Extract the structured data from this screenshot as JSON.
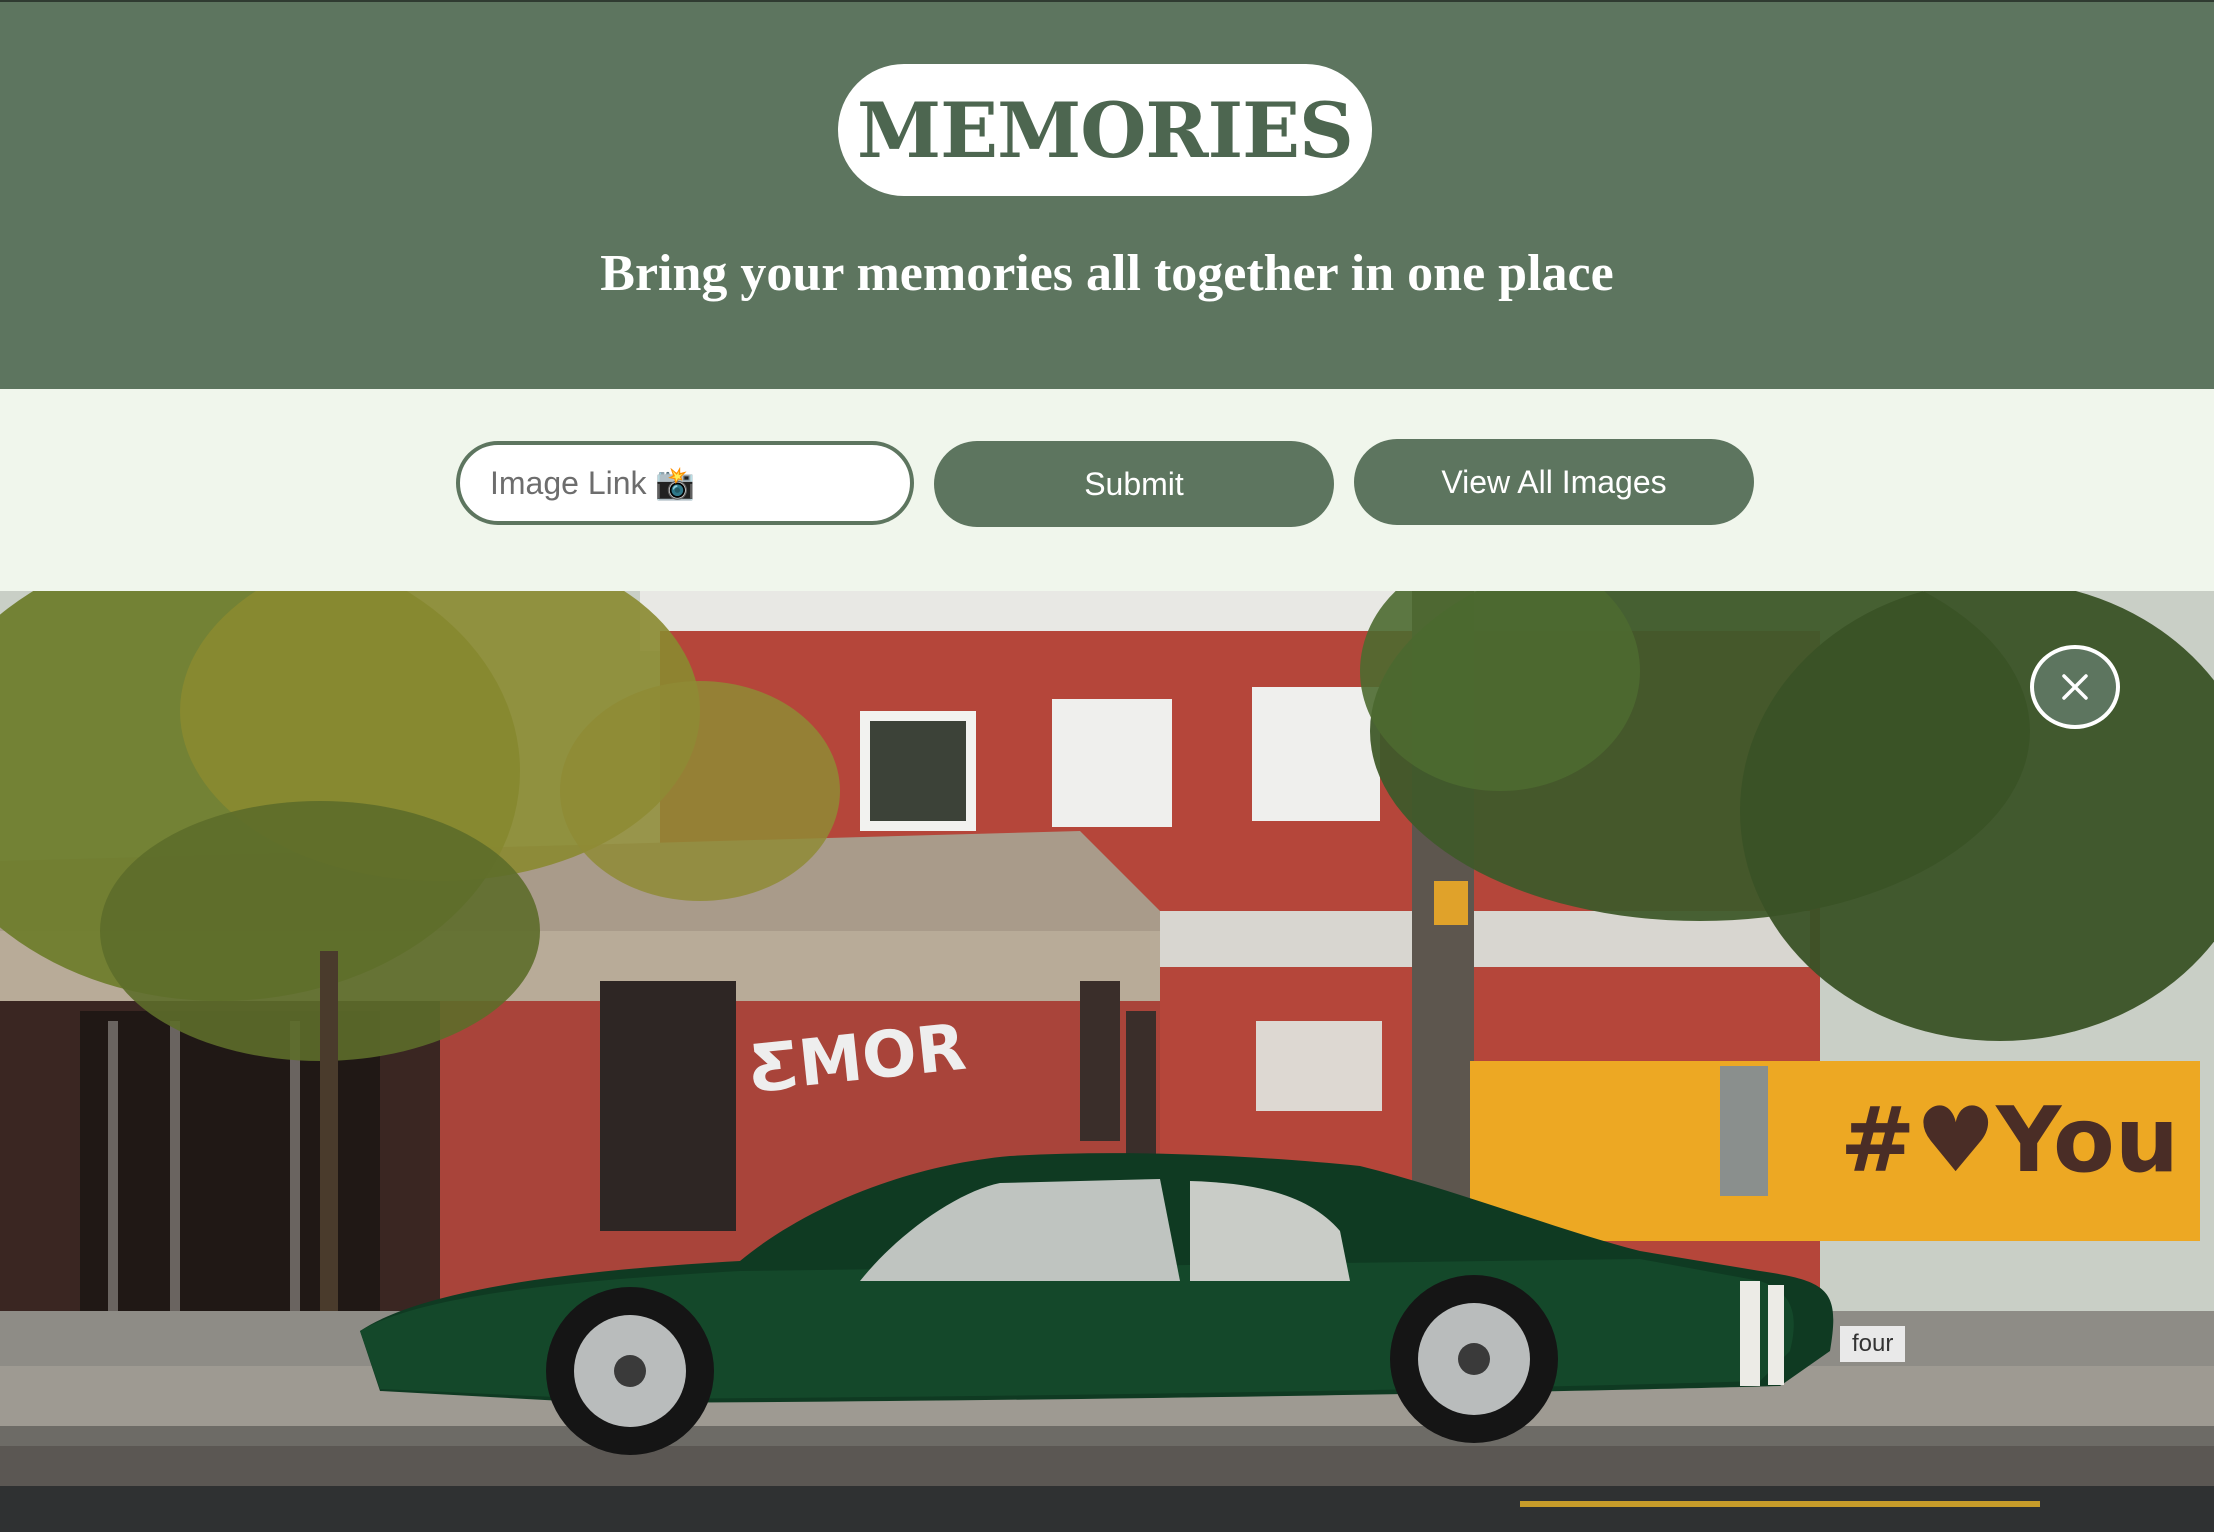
{
  "header": {
    "title": "MEMORIES",
    "subtitle": "Bring your memories all together in one place"
  },
  "toolbar": {
    "image_link_placeholder": "Image Link 📸",
    "image_link_value": "",
    "submit_label": "Submit",
    "view_all_label": "View All Images"
  },
  "viewer": {
    "caption": "four",
    "close_icon": "close-icon"
  },
  "colors": {
    "brand": "#5d755f",
    "background": "#f0f6ec",
    "white": "#ffffff"
  }
}
